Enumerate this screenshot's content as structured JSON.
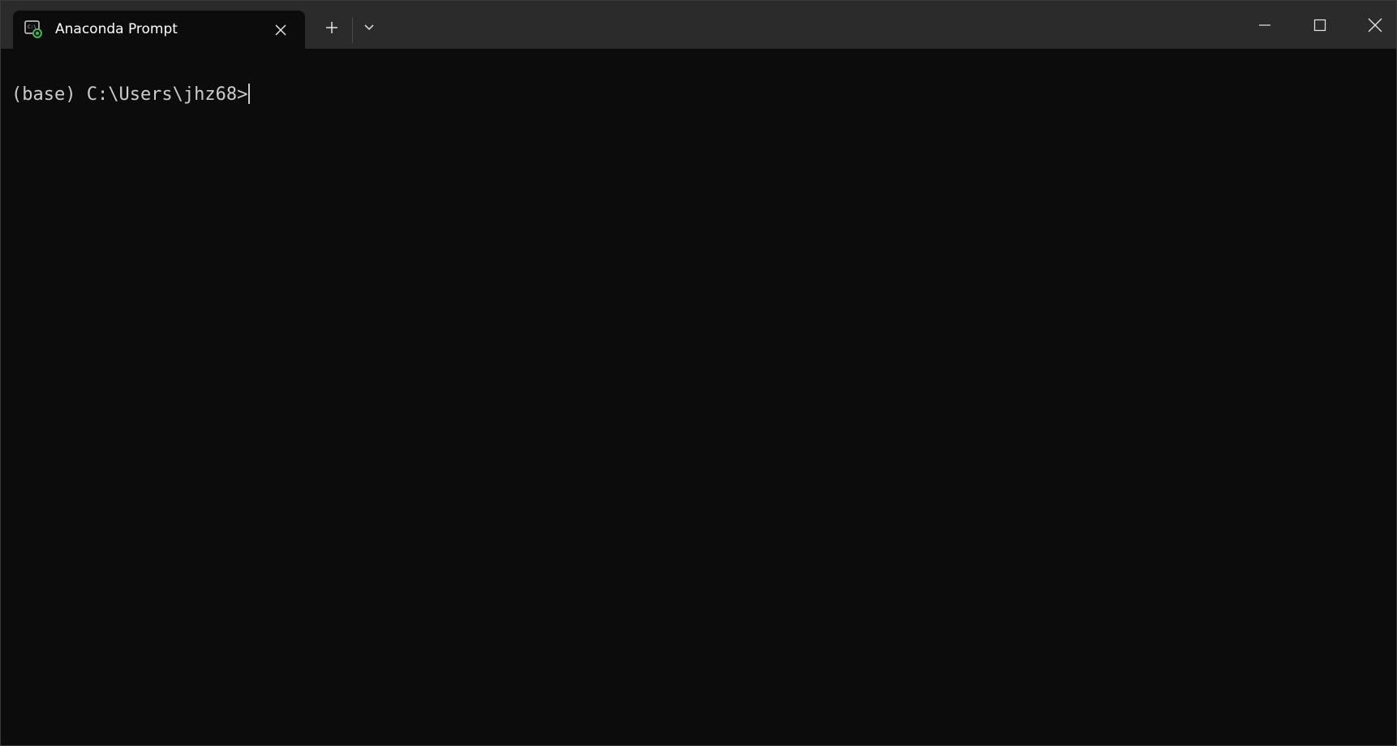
{
  "window": {
    "tab_title": "Anaconda Prompt",
    "tab_icon": "terminal-icon",
    "close_tab_icon": "close-icon",
    "new_tab_icon": "plus-icon",
    "dropdown_icon": "chevron-down-icon",
    "minimize_icon": "minimize-icon",
    "maximize_icon": "maximize-icon",
    "close_window_icon": "close-icon"
  },
  "terminal": {
    "prompt": "(base) C:\\Users\\jhz68>"
  },
  "colors": {
    "background": "#0c0c0c",
    "titlebar": "#2b2b2b",
    "text": "#cccccc",
    "icon_accent": "#3fb950"
  }
}
